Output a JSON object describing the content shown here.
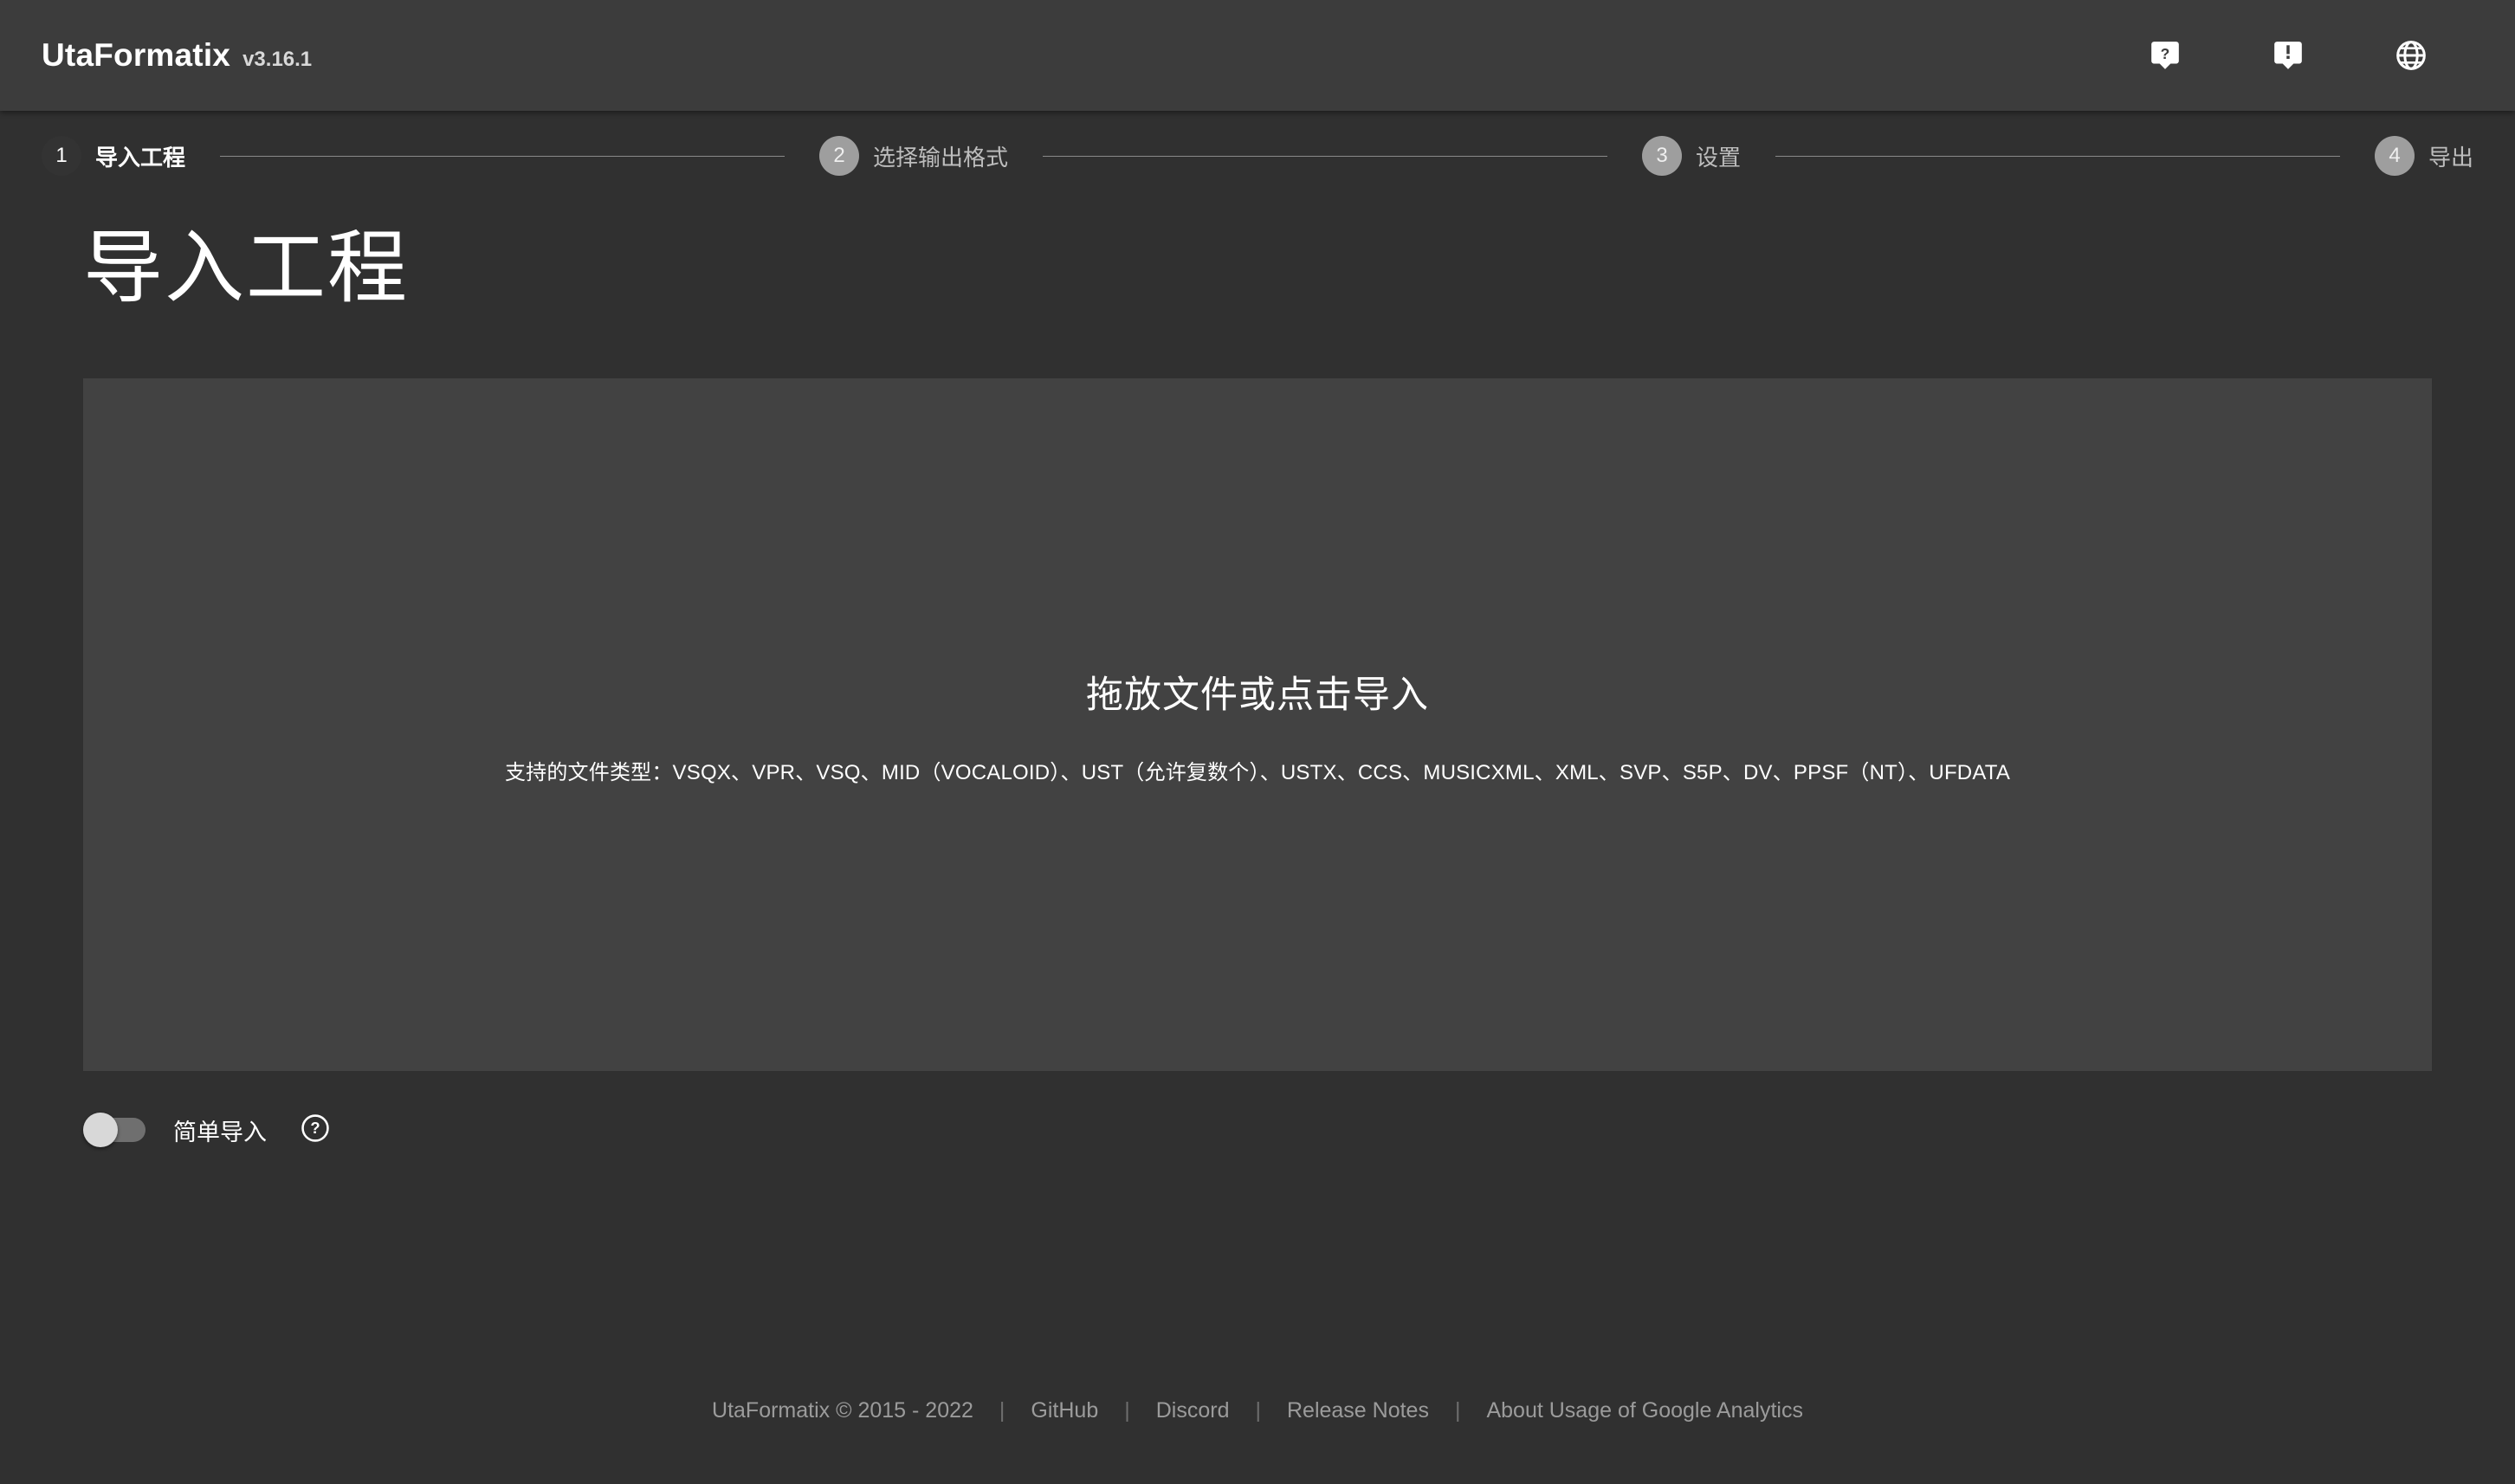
{
  "appbar": {
    "brand_name": "UtaFormatix",
    "version": "v3.16.1",
    "actions": [
      {
        "name": "help-icon",
        "label": "Help"
      },
      {
        "name": "feedback-icon",
        "label": "Feedback"
      },
      {
        "name": "language-icon",
        "label": "Language"
      }
    ]
  },
  "stepper": {
    "steps": [
      {
        "number": "1",
        "label": "导入工程",
        "active": true
      },
      {
        "number": "2",
        "label": "选择输出格式",
        "active": false
      },
      {
        "number": "3",
        "label": "设置",
        "active": false
      },
      {
        "number": "4",
        "label": "导出",
        "active": false
      }
    ]
  },
  "main": {
    "page_title": "导入工程",
    "dropzone": {
      "title": "拖放文件或点击导入",
      "subtitle": "支持的文件类型：VSQX、VPR、VSQ、MID（VOCALOID）、UST（允许复数个）、USTX、CCS、MUSICXML、XML、SVP、S5P、DV、PPSF（NT）、UFDATA"
    },
    "options": {
      "simple_import_label": "简单导入",
      "simple_import_on": false,
      "help_icon": "question-circle-icon"
    }
  },
  "footer": {
    "copyright": "UtaFormatix © 2015 - 2022",
    "separator": "|",
    "links": [
      {
        "label": "GitHub"
      },
      {
        "label": "Discord"
      },
      {
        "label": "Release Notes"
      },
      {
        "label": "About Usage of Google Analytics"
      }
    ]
  },
  "colors": {
    "background": "#303030",
    "appbar": "#3c3c3c",
    "dropzone": "#424242",
    "step_inactive_circle": "#9e9e9e",
    "step_inactive_label": "#bdbdbd",
    "footer_text": "#9b9b9b"
  }
}
